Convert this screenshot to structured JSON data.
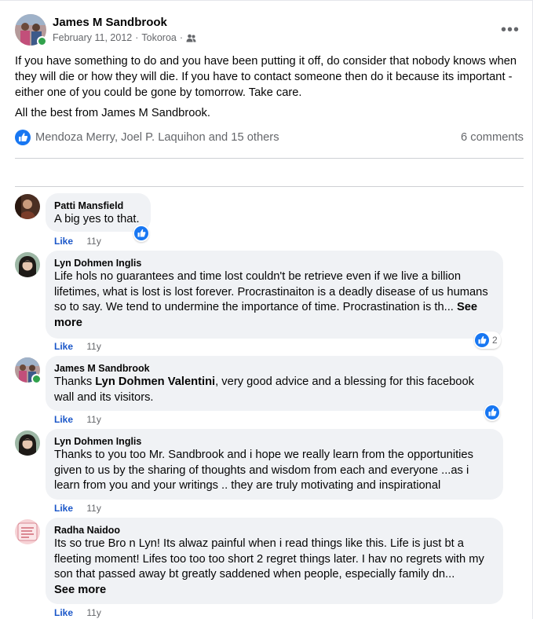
{
  "post": {
    "author": "James M Sandbrook",
    "date": "February 11, 2012",
    "location": "Tokoroa",
    "separator": "·",
    "more_label": "•••",
    "paragraph1": "If you have something to do and you have been putting it off, do consider that nobody knows when they will die or how they will die. If you have to contact someone then do it because its important - either one of you could be gone by tomorrow. Take care.",
    "paragraph2": "All the best from James M Sandbrook.",
    "reactions_text": "Mendoza Merry, Joel P. Laquihon and 15 others",
    "comments_count": "6 comments"
  },
  "comments": [
    {
      "name": "Patti Mansfield",
      "text": "A big yes to that.",
      "like": "Like",
      "time": "11y"
    },
    {
      "name": "Lyn Dohmen Inglis",
      "text": "Life hols no guarantees and time lost couldn't be retrieve even if we live a billion lifetimes, what is lost is lost forever. Procrastinaiton is a deadly disease of us humans so to say. We tend to undermine the importance of time. Procrastination is th...",
      "see_more": "See more",
      "like": "Like",
      "time": "11y",
      "reaction_count": "2"
    },
    {
      "name": "James M Sandbrook",
      "text_before": "Thanks ",
      "mention": "Lyn Dohmen Valentini",
      "text_after": ", very good advice and a blessing for this facebook wall and its visitors.",
      "like": "Like",
      "time": "11y"
    },
    {
      "name": "Lyn Dohmen Inglis",
      "text": "Thanks to you too Mr. Sandbrook and i hope we really learn from the opportunities given to us by the sharing of thoughts and wisdom from each and everyone ...as i learn from you and your writings .. they are truly motivating and inspirational",
      "like": "Like",
      "time": "11y"
    },
    {
      "name": "Radha Naidoo",
      "text": "Its so true Bro n Lyn! Its alwaz painful when i read things like this. Life is just bt a fleeting moment! Lifes too too too short 2 regret things later. I hav no regrets with my son that passed away bt greatly saddened when people, especially family dn...",
      "see_more": "See more",
      "like": "Like",
      "time": "11y"
    }
  ],
  "colors": {
    "accent": "#1877f2",
    "online": "#31a24c",
    "bubble": "#f0f2f5",
    "muted": "#65676b"
  }
}
